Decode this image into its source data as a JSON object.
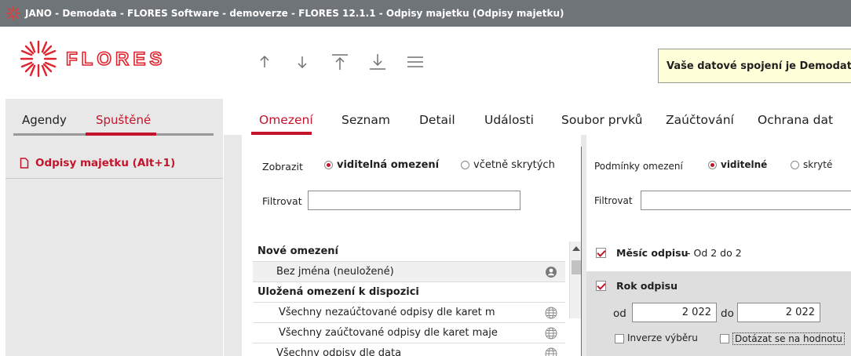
{
  "window": {
    "title": "JANO - Demodata - FLORES Software - demoverze - FLORES 12.1.1 - Odpisy majetku  (Odpisy majetku)"
  },
  "header": {
    "logo_text": "FLORES",
    "toolbar": [
      "arrow-up-icon",
      "arrow-down-icon",
      "arrow-to-top-icon",
      "arrow-to-bottom-icon",
      "menu-icon"
    ],
    "connection_text": "Vaše datové spojení je Demodata"
  },
  "colors": {
    "accent": "#c4142b",
    "titlebar": "#6f7479",
    "panel": "#e8e8e8",
    "notice": "#ffffd9"
  },
  "left_panel": {
    "tabs": [
      "Agendy",
      "Spuštěné"
    ],
    "active_tab": "Spuštěné",
    "items": [
      "Odpisy majetku (Alt+1)"
    ]
  },
  "main": {
    "tabs": [
      "Omezení",
      "Seznam",
      "Detail",
      "Události",
      "Soubor prvků",
      "Zaúčtování",
      "Ochrana dat"
    ],
    "active_tab": "Omezení",
    "left": {
      "show_label": "Zobrazit",
      "show_options": [
        "viditelná omezení",
        "včetně skrytých"
      ],
      "filter_label": "Filtrovat",
      "filter_value": "",
      "list": [
        {
          "type": "group",
          "text": "Nové omezení"
        },
        {
          "type": "item",
          "text": "Bez jména (neuložené)",
          "icon": "user-icon"
        },
        {
          "type": "group",
          "text": "Uložená omezení k dispozici"
        },
        {
          "type": "item",
          "text": "Všechny nezaúčtované odpisy dle karet m",
          "icon": "globe-icon"
        },
        {
          "type": "item",
          "text": "Všechny zaúčtované odpisy dle karet maje",
          "icon": "globe-icon"
        },
        {
          "type": "item",
          "text": "Všechny odpisy dle data",
          "icon": "globe-icon"
        }
      ]
    },
    "right": {
      "conditions_label": "Podmínky omezení",
      "conditions_options": [
        "viditelné",
        "skryté"
      ],
      "filter_label": "Filtrovat",
      "filter_value": "",
      "cond1": {
        "checked": true,
        "label": "Měsíc odpisu",
        "detail": "- Od 2 do 2"
      },
      "cond2": {
        "checked": true,
        "label": "Rok odpisu",
        "from_label": "od",
        "from_value": "2 022",
        "to_label": "do",
        "to_value": "2 022",
        "inverse_label": "Inverze výběru",
        "ask_label": "Dotázat se na hodnotu"
      }
    }
  }
}
